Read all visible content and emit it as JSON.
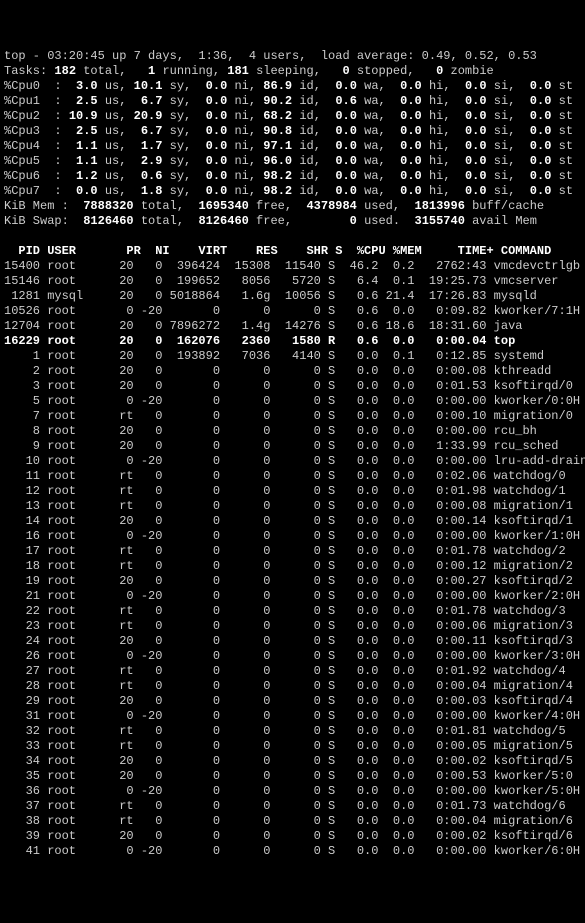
{
  "header": {
    "line1_a": "top - 03:20:45 up 7 days,  1:36,  4 users,  load average: 0.49, 0.52, 0.53",
    "tasks_lbl": "Tasks:",
    "tasks_total": " 182 ",
    "tasks_total_lbl": "total,   ",
    "tasks_run": "1 ",
    "tasks_run_lbl": "running, ",
    "tasks_sleep": "181 ",
    "tasks_sleep_lbl": "sleeping,   ",
    "tasks_stop": "0 ",
    "tasks_stop_lbl": "stopped,   ",
    "tasks_zomb": "0 ",
    "tasks_zomb_lbl": "zombie"
  },
  "cpus": [
    {
      "n": "0",
      "us": "3.0",
      "sy": "10.1",
      "ni": "0.0",
      "id": "86.9",
      "wa": "0.0",
      "hi": "0.0",
      "si": "0.0",
      "st": "0.0"
    },
    {
      "n": "1",
      "us": "2.5",
      "sy": "6.7",
      "ni": "0.0",
      "id": "90.2",
      "wa": "0.6",
      "hi": "0.0",
      "si": "0.0",
      "st": "0.0"
    },
    {
      "n": "2",
      "us": "10.9",
      "sy": "20.9",
      "ni": "0.0",
      "id": "68.2",
      "wa": "0.0",
      "hi": "0.0",
      "si": "0.0",
      "st": "0.0"
    },
    {
      "n": "3",
      "us": "2.5",
      "sy": "6.7",
      "ni": "0.0",
      "id": "90.8",
      "wa": "0.0",
      "hi": "0.0",
      "si": "0.0",
      "st": "0.0"
    },
    {
      "n": "4",
      "us": "1.1",
      "sy": "1.7",
      "ni": "0.0",
      "id": "97.1",
      "wa": "0.0",
      "hi": "0.0",
      "si": "0.0",
      "st": "0.0"
    },
    {
      "n": "5",
      "us": "1.1",
      "sy": "2.9",
      "ni": "0.0",
      "id": "96.0",
      "wa": "0.0",
      "hi": "0.0",
      "si": "0.0",
      "st": "0.0"
    },
    {
      "n": "6",
      "us": "1.2",
      "sy": "0.6",
      "ni": "0.0",
      "id": "98.2",
      "wa": "0.0",
      "hi": "0.0",
      "si": "0.0",
      "st": "0.0"
    },
    {
      "n": "7",
      "us": "0.0",
      "sy": "1.8",
      "ni": "0.0",
      "id": "98.2",
      "wa": "0.0",
      "hi": "0.0",
      "si": "0.0",
      "st": "0.0"
    }
  ],
  "mem": {
    "label": "KiB Mem :  ",
    "total": "7888320 ",
    "total_lbl": "total,  ",
    "free": "1695340 ",
    "free_lbl": "free,  ",
    "used": "4378984 ",
    "used_lbl": "used,  ",
    "buff": "1813996 ",
    "buff_lbl": "buff/cache"
  },
  "swap": {
    "label": "KiB Swap:  ",
    "total": "8126460 ",
    "total_lbl": "total,  ",
    "free": "8126460 ",
    "free_lbl": "free,        ",
    "used": "0 ",
    "used_lbl": "used.  ",
    "avail": "3155740 ",
    "avail_lbl": "avail Mem"
  },
  "cols": {
    "pid": "  PID",
    "user": "USER      ",
    "pr": "PR",
    "ni": " NI",
    "virt": "   VIRT",
    "res": "   RES",
    "shr": "   SHR",
    "s": "S",
    "cpu": " %CPU",
    "mem": "%MEM",
    "time": "    TIME+",
    "cmd": "COMMAND"
  },
  "procs": [
    {
      "pid": "15400",
      "user": "root",
      "pr": "20",
      "ni": "0",
      "virt": "396424",
      "res": "15308",
      "shr": "11540",
      "s": "S",
      "cpu": "46.2",
      "mem": "0.2",
      "time": "2762:43",
      "cmd": "vmcdevctrlgb",
      "hl": false
    },
    {
      "pid": "15146",
      "user": "root",
      "pr": "20",
      "ni": "0",
      "virt": "199652",
      "res": "8056",
      "shr": "5720",
      "s": "S",
      "cpu": "6.4",
      "mem": "0.1",
      "time": "19:25.73",
      "cmd": "vmcserver",
      "hl": false
    },
    {
      "pid": "1281",
      "user": "mysql",
      "pr": "20",
      "ni": "0",
      "virt": "5018864",
      "res": "1.6g",
      "shr": "10056",
      "s": "S",
      "cpu": "0.6",
      "mem": "21.4",
      "time": "17:26.83",
      "cmd": "mysqld",
      "hl": false
    },
    {
      "pid": "10526",
      "user": "root",
      "pr": "0",
      "ni": "-20",
      "virt": "0",
      "res": "0",
      "shr": "0",
      "s": "S",
      "cpu": "0.6",
      "mem": "0.0",
      "time": "0:09.82",
      "cmd": "kworker/7:1H",
      "hl": false
    },
    {
      "pid": "12704",
      "user": "root",
      "pr": "20",
      "ni": "0",
      "virt": "7896272",
      "res": "1.4g",
      "shr": "14276",
      "s": "S",
      "cpu": "0.6",
      "mem": "18.6",
      "time": "18:31.60",
      "cmd": "java",
      "hl": false
    },
    {
      "pid": "16229",
      "user": "root",
      "pr": "20",
      "ni": "0",
      "virt": "162076",
      "res": "2360",
      "shr": "1580",
      "s": "R",
      "cpu": "0.6",
      "mem": "0.0",
      "time": "0:00.04",
      "cmd": "top",
      "hl": true
    },
    {
      "pid": "1",
      "user": "root",
      "pr": "20",
      "ni": "0",
      "virt": "193892",
      "res": "7036",
      "shr": "4140",
      "s": "S",
      "cpu": "0.0",
      "mem": "0.1",
      "time": "0:12.85",
      "cmd": "systemd",
      "hl": false
    },
    {
      "pid": "2",
      "user": "root",
      "pr": "20",
      "ni": "0",
      "virt": "0",
      "res": "0",
      "shr": "0",
      "s": "S",
      "cpu": "0.0",
      "mem": "0.0",
      "time": "0:00.08",
      "cmd": "kthreadd",
      "hl": false
    },
    {
      "pid": "3",
      "user": "root",
      "pr": "20",
      "ni": "0",
      "virt": "0",
      "res": "0",
      "shr": "0",
      "s": "S",
      "cpu": "0.0",
      "mem": "0.0",
      "time": "0:01.53",
      "cmd": "ksoftirqd/0",
      "hl": false
    },
    {
      "pid": "5",
      "user": "root",
      "pr": "0",
      "ni": "-20",
      "virt": "0",
      "res": "0",
      "shr": "0",
      "s": "S",
      "cpu": "0.0",
      "mem": "0.0",
      "time": "0:00.00",
      "cmd": "kworker/0:0H",
      "hl": false
    },
    {
      "pid": "7",
      "user": "root",
      "pr": "rt",
      "ni": "0",
      "virt": "0",
      "res": "0",
      "shr": "0",
      "s": "S",
      "cpu": "0.0",
      "mem": "0.0",
      "time": "0:00.10",
      "cmd": "migration/0",
      "hl": false
    },
    {
      "pid": "8",
      "user": "root",
      "pr": "20",
      "ni": "0",
      "virt": "0",
      "res": "0",
      "shr": "0",
      "s": "S",
      "cpu": "0.0",
      "mem": "0.0",
      "time": "0:00.00",
      "cmd": "rcu_bh",
      "hl": false
    },
    {
      "pid": "9",
      "user": "root",
      "pr": "20",
      "ni": "0",
      "virt": "0",
      "res": "0",
      "shr": "0",
      "s": "S",
      "cpu": "0.0",
      "mem": "0.0",
      "time": "1:33.99",
      "cmd": "rcu_sched",
      "hl": false
    },
    {
      "pid": "10",
      "user": "root",
      "pr": "0",
      "ni": "-20",
      "virt": "0",
      "res": "0",
      "shr": "0",
      "s": "S",
      "cpu": "0.0",
      "mem": "0.0",
      "time": "0:00.00",
      "cmd": "lru-add-drain",
      "hl": false
    },
    {
      "pid": "11",
      "user": "root",
      "pr": "rt",
      "ni": "0",
      "virt": "0",
      "res": "0",
      "shr": "0",
      "s": "S",
      "cpu": "0.0",
      "mem": "0.0",
      "time": "0:02.06",
      "cmd": "watchdog/0",
      "hl": false
    },
    {
      "pid": "12",
      "user": "root",
      "pr": "rt",
      "ni": "0",
      "virt": "0",
      "res": "0",
      "shr": "0",
      "s": "S",
      "cpu": "0.0",
      "mem": "0.0",
      "time": "0:01.98",
      "cmd": "watchdog/1",
      "hl": false
    },
    {
      "pid": "13",
      "user": "root",
      "pr": "rt",
      "ni": "0",
      "virt": "0",
      "res": "0",
      "shr": "0",
      "s": "S",
      "cpu": "0.0",
      "mem": "0.0",
      "time": "0:00.08",
      "cmd": "migration/1",
      "hl": false
    },
    {
      "pid": "14",
      "user": "root",
      "pr": "20",
      "ni": "0",
      "virt": "0",
      "res": "0",
      "shr": "0",
      "s": "S",
      "cpu": "0.0",
      "mem": "0.0",
      "time": "0:00.14",
      "cmd": "ksoftirqd/1",
      "hl": false
    },
    {
      "pid": "16",
      "user": "root",
      "pr": "0",
      "ni": "-20",
      "virt": "0",
      "res": "0",
      "shr": "0",
      "s": "S",
      "cpu": "0.0",
      "mem": "0.0",
      "time": "0:00.00",
      "cmd": "kworker/1:0H",
      "hl": false
    },
    {
      "pid": "17",
      "user": "root",
      "pr": "rt",
      "ni": "0",
      "virt": "0",
      "res": "0",
      "shr": "0",
      "s": "S",
      "cpu": "0.0",
      "mem": "0.0",
      "time": "0:01.78",
      "cmd": "watchdog/2",
      "hl": false
    },
    {
      "pid": "18",
      "user": "root",
      "pr": "rt",
      "ni": "0",
      "virt": "0",
      "res": "0",
      "shr": "0",
      "s": "S",
      "cpu": "0.0",
      "mem": "0.0",
      "time": "0:00.12",
      "cmd": "migration/2",
      "hl": false
    },
    {
      "pid": "19",
      "user": "root",
      "pr": "20",
      "ni": "0",
      "virt": "0",
      "res": "0",
      "shr": "0",
      "s": "S",
      "cpu": "0.0",
      "mem": "0.0",
      "time": "0:00.27",
      "cmd": "ksoftirqd/2",
      "hl": false
    },
    {
      "pid": "21",
      "user": "root",
      "pr": "0",
      "ni": "-20",
      "virt": "0",
      "res": "0",
      "shr": "0",
      "s": "S",
      "cpu": "0.0",
      "mem": "0.0",
      "time": "0:00.00",
      "cmd": "kworker/2:0H",
      "hl": false
    },
    {
      "pid": "22",
      "user": "root",
      "pr": "rt",
      "ni": "0",
      "virt": "0",
      "res": "0",
      "shr": "0",
      "s": "S",
      "cpu": "0.0",
      "mem": "0.0",
      "time": "0:01.78",
      "cmd": "watchdog/3",
      "hl": false
    },
    {
      "pid": "23",
      "user": "root",
      "pr": "rt",
      "ni": "0",
      "virt": "0",
      "res": "0",
      "shr": "0",
      "s": "S",
      "cpu": "0.0",
      "mem": "0.0",
      "time": "0:00.06",
      "cmd": "migration/3",
      "hl": false
    },
    {
      "pid": "24",
      "user": "root",
      "pr": "20",
      "ni": "0",
      "virt": "0",
      "res": "0",
      "shr": "0",
      "s": "S",
      "cpu": "0.0",
      "mem": "0.0",
      "time": "0:00.11",
      "cmd": "ksoftirqd/3",
      "hl": false
    },
    {
      "pid": "26",
      "user": "root",
      "pr": "0",
      "ni": "-20",
      "virt": "0",
      "res": "0",
      "shr": "0",
      "s": "S",
      "cpu": "0.0",
      "mem": "0.0",
      "time": "0:00.00",
      "cmd": "kworker/3:0H",
      "hl": false
    },
    {
      "pid": "27",
      "user": "root",
      "pr": "rt",
      "ni": "0",
      "virt": "0",
      "res": "0",
      "shr": "0",
      "s": "S",
      "cpu": "0.0",
      "mem": "0.0",
      "time": "0:01.92",
      "cmd": "watchdog/4",
      "hl": false
    },
    {
      "pid": "28",
      "user": "root",
      "pr": "rt",
      "ni": "0",
      "virt": "0",
      "res": "0",
      "shr": "0",
      "s": "S",
      "cpu": "0.0",
      "mem": "0.0",
      "time": "0:00.04",
      "cmd": "migration/4",
      "hl": false
    },
    {
      "pid": "29",
      "user": "root",
      "pr": "20",
      "ni": "0",
      "virt": "0",
      "res": "0",
      "shr": "0",
      "s": "S",
      "cpu": "0.0",
      "mem": "0.0",
      "time": "0:00.03",
      "cmd": "ksoftirqd/4",
      "hl": false
    },
    {
      "pid": "31",
      "user": "root",
      "pr": "0",
      "ni": "-20",
      "virt": "0",
      "res": "0",
      "shr": "0",
      "s": "S",
      "cpu": "0.0",
      "mem": "0.0",
      "time": "0:00.00",
      "cmd": "kworker/4:0H",
      "hl": false
    },
    {
      "pid": "32",
      "user": "root",
      "pr": "rt",
      "ni": "0",
      "virt": "0",
      "res": "0",
      "shr": "0",
      "s": "S",
      "cpu": "0.0",
      "mem": "0.0",
      "time": "0:01.81",
      "cmd": "watchdog/5",
      "hl": false
    },
    {
      "pid": "33",
      "user": "root",
      "pr": "rt",
      "ni": "0",
      "virt": "0",
      "res": "0",
      "shr": "0",
      "s": "S",
      "cpu": "0.0",
      "mem": "0.0",
      "time": "0:00.05",
      "cmd": "migration/5",
      "hl": false
    },
    {
      "pid": "34",
      "user": "root",
      "pr": "20",
      "ni": "0",
      "virt": "0",
      "res": "0",
      "shr": "0",
      "s": "S",
      "cpu": "0.0",
      "mem": "0.0",
      "time": "0:00.02",
      "cmd": "ksoftirqd/5",
      "hl": false
    },
    {
      "pid": "35",
      "user": "root",
      "pr": "20",
      "ni": "0",
      "virt": "0",
      "res": "0",
      "shr": "0",
      "s": "S",
      "cpu": "0.0",
      "mem": "0.0",
      "time": "0:00.53",
      "cmd": "kworker/5:0",
      "hl": false
    },
    {
      "pid": "36",
      "user": "root",
      "pr": "0",
      "ni": "-20",
      "virt": "0",
      "res": "0",
      "shr": "0",
      "s": "S",
      "cpu": "0.0",
      "mem": "0.0",
      "time": "0:00.00",
      "cmd": "kworker/5:0H",
      "hl": false
    },
    {
      "pid": "37",
      "user": "root",
      "pr": "rt",
      "ni": "0",
      "virt": "0",
      "res": "0",
      "shr": "0",
      "s": "S",
      "cpu": "0.0",
      "mem": "0.0",
      "time": "0:01.73",
      "cmd": "watchdog/6",
      "hl": false
    },
    {
      "pid": "38",
      "user": "root",
      "pr": "rt",
      "ni": "0",
      "virt": "0",
      "res": "0",
      "shr": "0",
      "s": "S",
      "cpu": "0.0",
      "mem": "0.0",
      "time": "0:00.04",
      "cmd": "migration/6",
      "hl": false
    },
    {
      "pid": "39",
      "user": "root",
      "pr": "20",
      "ni": "0",
      "virt": "0",
      "res": "0",
      "shr": "0",
      "s": "S",
      "cpu": "0.0",
      "mem": "0.0",
      "time": "0:00.02",
      "cmd": "ksoftirqd/6",
      "hl": false
    },
    {
      "pid": "41",
      "user": "root",
      "pr": "0",
      "ni": "-20",
      "virt": "0",
      "res": "0",
      "shr": "0",
      "s": "S",
      "cpu": "0.0",
      "mem": "0.0",
      "time": "0:00.00",
      "cmd": "kworker/6:0H",
      "hl": false
    }
  ]
}
